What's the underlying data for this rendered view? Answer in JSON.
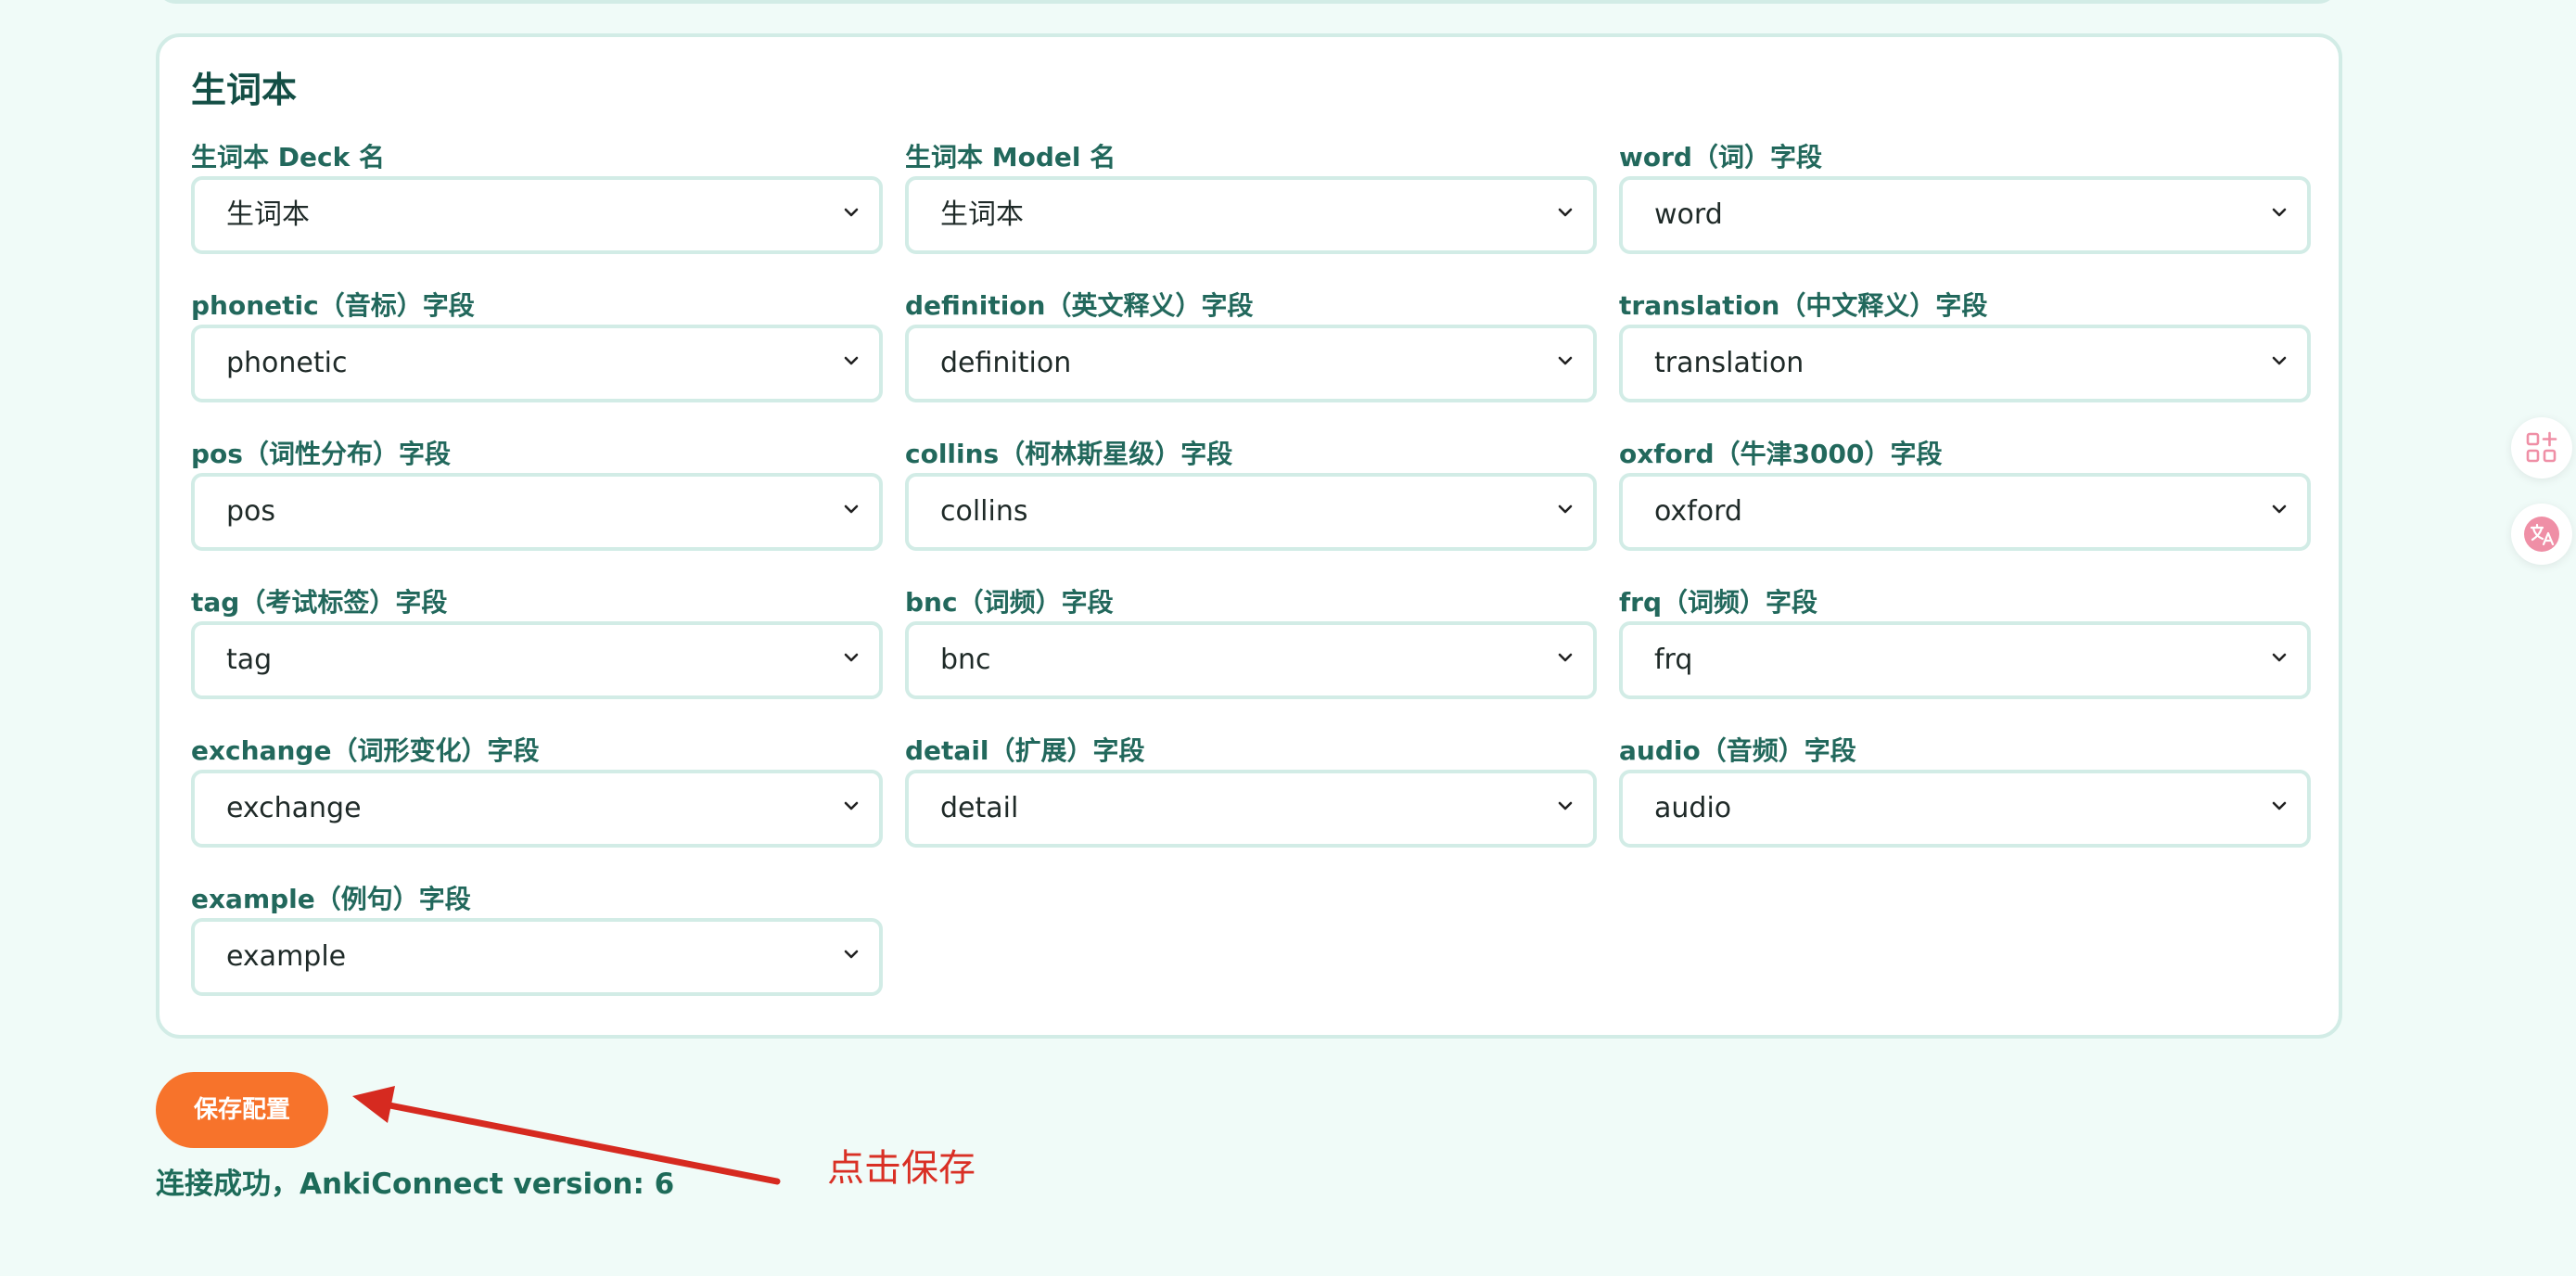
{
  "card": {
    "title": "生词本"
  },
  "fields": [
    {
      "label": "生词本 Deck 名",
      "value": "生词本"
    },
    {
      "label": "生词本 Model 名",
      "value": "生词本"
    },
    {
      "label": "word（词）字段",
      "value": "word"
    },
    {
      "label": "phonetic（音标）字段",
      "value": "phonetic"
    },
    {
      "label": "definition（英文释义）字段",
      "value": "definition"
    },
    {
      "label": "translation（中文释义）字段",
      "value": "translation"
    },
    {
      "label": "pos（词性分布）字段",
      "value": "pos"
    },
    {
      "label": "collins（柯林斯星级）字段",
      "value": "collins"
    },
    {
      "label": "oxford（牛津3000）字段",
      "value": "oxford"
    },
    {
      "label": "tag（考试标签）字段",
      "value": "tag"
    },
    {
      "label": "bnc（词频）字段",
      "value": "bnc"
    },
    {
      "label": "frq（词频）字段",
      "value": "frq"
    },
    {
      "label": "exchange（词形变化）字段",
      "value": "exchange"
    },
    {
      "label": "detail（扩展）字段",
      "value": "detail"
    },
    {
      "label": "audio（音频）字段",
      "value": "audio"
    },
    {
      "label": "example（例句）字段",
      "value": "example"
    }
  ],
  "actions": {
    "save_label": "保存配置"
  },
  "status": {
    "text": "连接成功，AnkiConnect version: 6"
  },
  "annotation": {
    "text": "点击保存",
    "color": "#d93025"
  },
  "icons": {
    "chevron": "chevron-down-icon",
    "float_top": "apps-add-icon",
    "float_bottom": "translate-icon"
  },
  "colors": {
    "accent": "#f7732b",
    "heading": "#134e45",
    "label": "#22685c",
    "border": "#d2ece6",
    "background": "#f0fbf8",
    "float_icon": "#ef8fa6"
  }
}
